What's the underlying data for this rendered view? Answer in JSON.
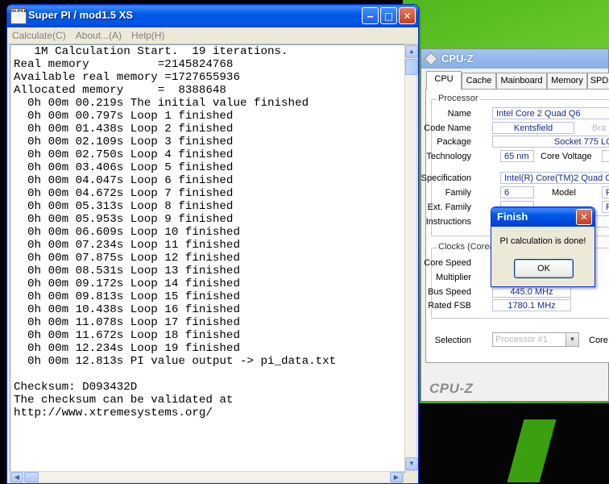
{
  "superpi": {
    "title": "Super PI / mod1.5 XS",
    "icon_label": "SUPER",
    "menu": [
      "Calculate(C)",
      "About...(A)",
      "Help(H)"
    ],
    "output_lines": [
      "   1M Calculation Start.  19 iterations.",
      "Real memory          =2145824768",
      "Available real memory =1727655936",
      "Allocated memory     =  8388648",
      "  0h 00m 00.219s The initial value finished",
      "  0h 00m 00.797s Loop 1 finished",
      "  0h 00m 01.438s Loop 2 finished",
      "  0h 00m 02.109s Loop 3 finished",
      "  0h 00m 02.750s Loop 4 finished",
      "  0h 00m 03.406s Loop 5 finished",
      "  0h 00m 04.047s Loop 6 finished",
      "  0h 00m 04.672s Loop 7 finished",
      "  0h 00m 05.313s Loop 8 finished",
      "  0h 00m 05.953s Loop 9 finished",
      "  0h 00m 06.609s Loop 10 finished",
      "  0h 00m 07.234s Loop 11 finished",
      "  0h 00m 07.875s Loop 12 finished",
      "  0h 00m 08.531s Loop 13 finished",
      "  0h 00m 09.172s Loop 14 finished",
      "  0h 00m 09.813s Loop 15 finished",
      "  0h 00m 10.438s Loop 16 finished",
      "  0h 00m 11.078s Loop 17 finished",
      "  0h 00m 11.672s Loop 18 finished",
      "  0h 00m 12.234s Loop 19 finished",
      "  0h 00m 12.813s PI value output -> pi_data.txt",
      "",
      "Checksum: D093432D",
      "The checksum can be validated at",
      "http://www.xtremesystems.org/"
    ]
  },
  "cpuz": {
    "title": "CPU-Z",
    "tabs": [
      "CPU",
      "Cache",
      "Mainboard",
      "Memory",
      "SPD"
    ],
    "processor_label": "Processor",
    "name_label": "Name",
    "name_value": "Intel Core 2 Quad Q6",
    "codename_label": "Code Name",
    "codename_value": "Kentsfield",
    "brand_label": "Bra",
    "package_label": "Package",
    "package_value": "Socket 775 LGA",
    "technology_label": "Technology",
    "technology_value": "65 nm",
    "core_voltage_label": "Core Voltage",
    "specification_label": "Specification",
    "specification_value": "Intel(R) Core(TM)2 Quad C",
    "family_label": "Family",
    "family_value": "6",
    "model_label": "Model",
    "model_value": "F",
    "ext_family_label": "Ext. Family",
    "ext_model_value": "F",
    "instructions_label": "Instructions",
    "clocks_label": "Clocks (Core#",
    "core_speed_label": "Core Speed",
    "multiplier_label": "Multiplier",
    "bus_speed_label": "Bus Speed",
    "bus_speed_value": "445.0 MHz",
    "rated_fsb_label": "Rated FSB",
    "rated_fsb_value": "1780.1 MHz",
    "selection_label": "Selection",
    "selection_value": "Processor #1",
    "cores_label": "Core",
    "logo": "CPU-Z"
  },
  "finish_dialog": {
    "title": "Finish",
    "message": "PI calculation is done!",
    "ok_label": "OK"
  }
}
